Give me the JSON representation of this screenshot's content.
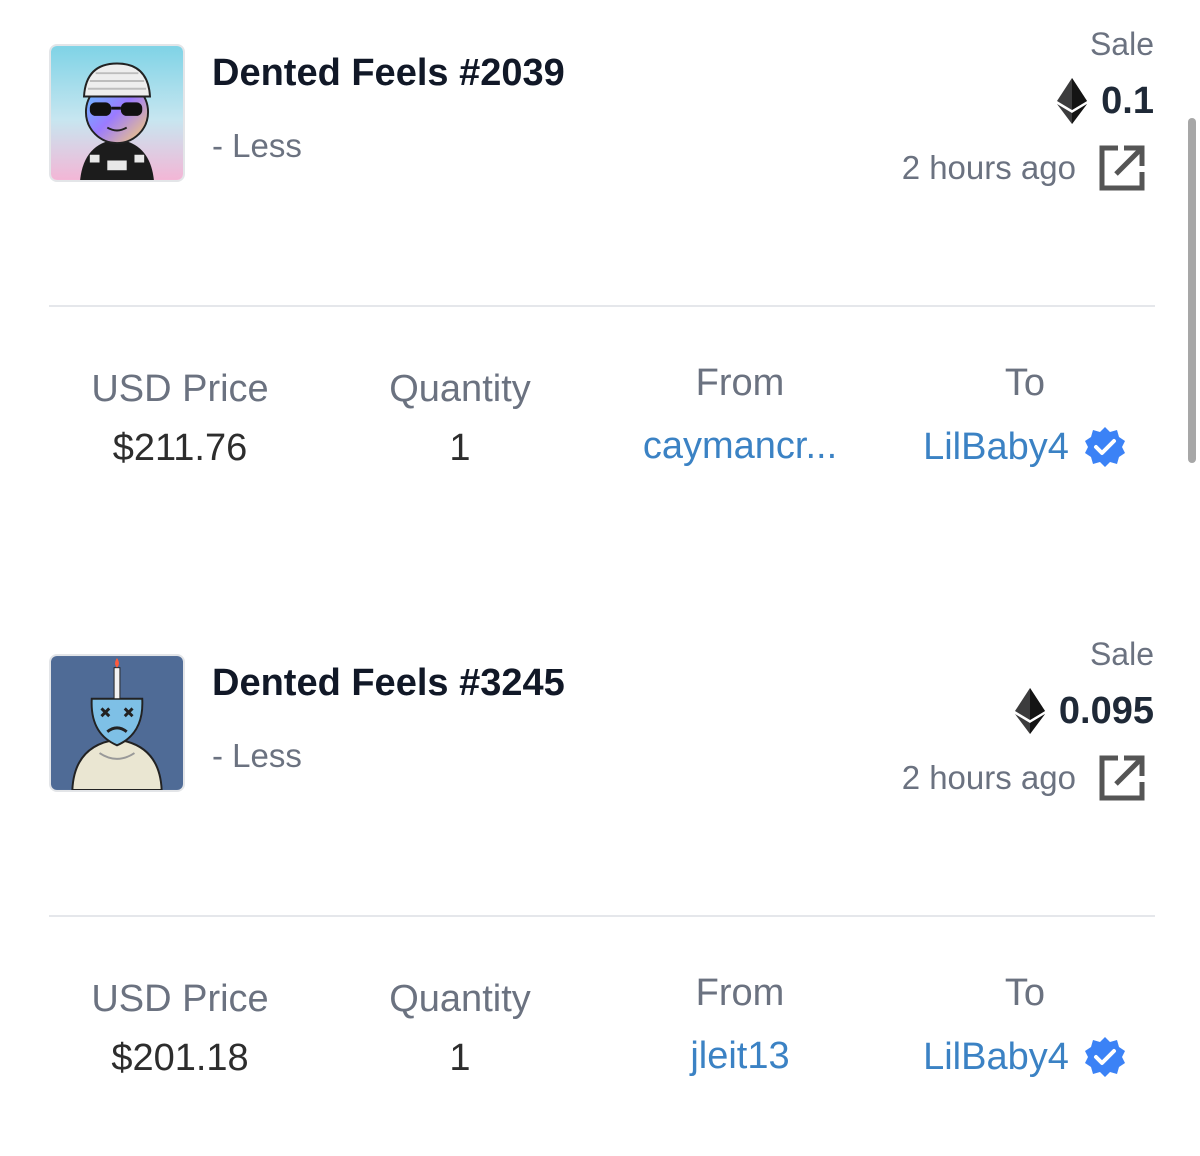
{
  "colors": {
    "accent_link": "#3b82c4",
    "verified_badge": "#3b82f6",
    "muted_text": "#6b7280",
    "heading_text": "#111827",
    "divider": "#e5e7eb"
  },
  "sales": [
    {
      "name": "Dented Feels #2039",
      "sub": "- Less",
      "type": "Sale",
      "price_eth": "0.1",
      "time": "2 hours ago",
      "usd_label": "USD Price",
      "usd": "$211.76",
      "qty_label": "Quantity",
      "qty": "1",
      "from_label": "From",
      "from": "caymancr...",
      "to_label": "To",
      "to": "LilBaby4",
      "thumbnail_icon": "nft-thumbnail-icon",
      "currency_icon": "ethereum-icon",
      "link_icon": "external-link-icon",
      "verified_icon": "verified-badge-icon"
    },
    {
      "name": "Dented Feels #3245",
      "sub": "- Less",
      "type": "Sale",
      "price_eth": "0.095",
      "time": "2 hours ago",
      "usd_label": "USD Price",
      "usd": "$201.18",
      "qty_label": "Quantity",
      "qty": "1",
      "from_label": "From",
      "from": "jleit13",
      "to_label": "To",
      "to": "LilBaby4",
      "thumbnail_icon": "nft-thumbnail-icon",
      "currency_icon": "ethereum-icon",
      "link_icon": "external-link-icon",
      "verified_icon": "verified-badge-icon"
    }
  ]
}
